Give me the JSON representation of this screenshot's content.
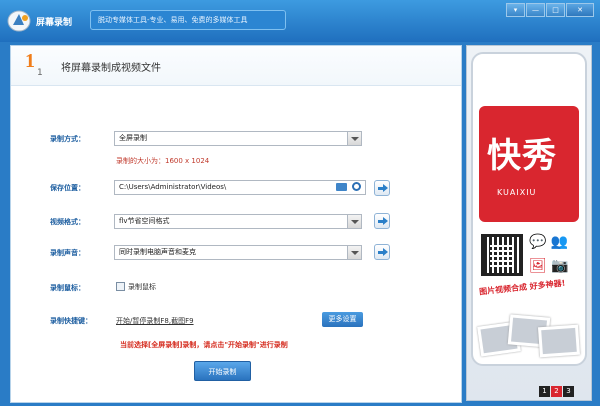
{
  "app": {
    "title": "屏幕录制",
    "slogan": "脱动专媒体工具-专业、易用、免费的多媒体工具"
  },
  "window_buttons": [
    "▾",
    "—",
    "□",
    "✕"
  ],
  "step": {
    "number": "1",
    "sub": "1",
    "title": "将屏幕录制成视频文件"
  },
  "form": {
    "record_mode_label": "录制方式：",
    "record_mode_value": "全屏录制",
    "size_note": "录制的大小为：1600 x 1024",
    "save_path_label": "保存位置：",
    "save_path_value": "C:\\Users\\Administrator\\Videos\\",
    "video_format_label": "视频格式：",
    "video_format_value": "flv节省空间格式",
    "audio_label": "录制声音：",
    "audio_value": "同时录制电脑声音和麦克",
    "mouse_label": "录制鼠标：",
    "mouse_checkbox_label": "录制鼠标",
    "hotkey_label": "录制快捷键：",
    "hotkey_value": "开始/暂停录制F8,截图F9",
    "more_settings": "更多设置",
    "tip": "当前选择[全屏录制]录制，请点击\"开始录制\"进行录制",
    "start_button": "开始录制"
  },
  "ad": {
    "brand_cn": "快秀",
    "brand_en": "KUAIXIU",
    "promo": "图片视频合成 好多神器!",
    "pages": [
      "1",
      "2",
      "3"
    ],
    "active_page": "2"
  },
  "colors": {
    "titlebar": "#1f6fbe",
    "label_blue": "#1d5ea0",
    "tip_red": "#d52b1e",
    "brand_red": "#d9262f"
  }
}
